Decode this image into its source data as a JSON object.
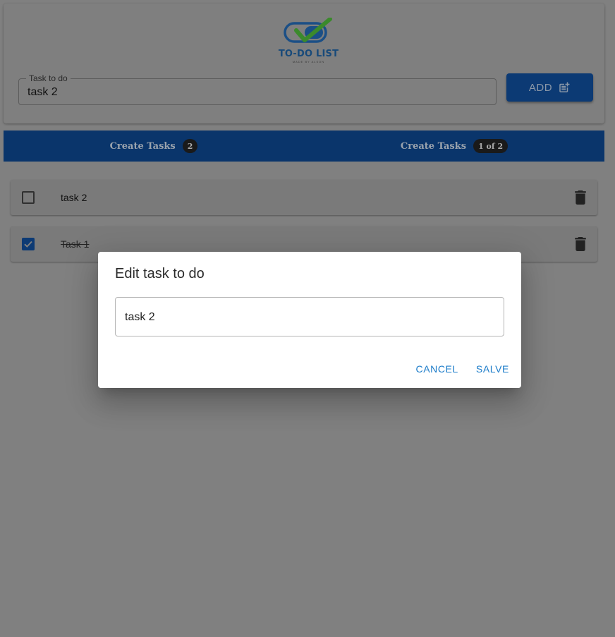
{
  "header": {
    "logo": {
      "title": "TO-DO LIST",
      "subtitle": "MADE BY ALSON",
      "icon": "checkmark-toggle-icon"
    },
    "task_input": {
      "label": "Task to do",
      "value": "task 2"
    },
    "add_button": {
      "label": "ADD",
      "icon": "post-add-icon"
    }
  },
  "tabs": [
    {
      "label": "Create Tasks",
      "badge": "2"
    },
    {
      "label": "Create Tasks",
      "badge": "1 of 2"
    }
  ],
  "tasks": [
    {
      "text": "task 2",
      "checked": false,
      "icon": "delete-icon"
    },
    {
      "text": "Task 1",
      "checked": true,
      "icon": "delete-icon"
    }
  ],
  "dialog": {
    "title": "Edit task to do",
    "input_value": "task 2",
    "cancel_label": "CANCEL",
    "save_label": "SALVE"
  },
  "colors": {
    "primary": "#1565c0",
    "backdrop": "#808080",
    "action_text": "#1976d2"
  }
}
